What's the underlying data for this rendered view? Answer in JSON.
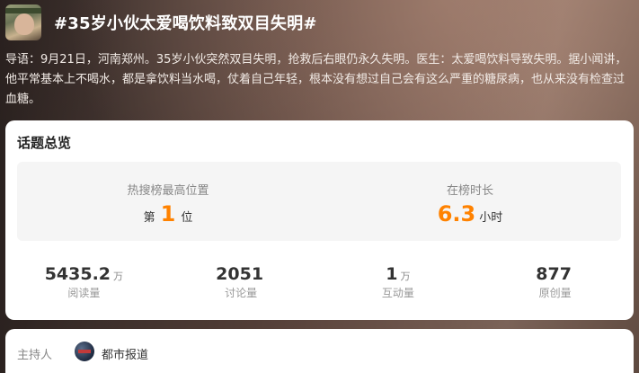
{
  "topic": {
    "title": "#35岁小伙太爱喝饮料致双目失明#",
    "thumbnail_icon": "topic-thumbnail-image",
    "intro": "导语：9月21日，河南郑州。35岁小伙突然双目失明，抢救后右眼仍永久失明。医生：太爱喝饮料导致失明。据小闻讲，他平常基本上不喝水，都是拿饮料当水喝，仗着自己年轻，根本没有想过自己会有这么严重的糖尿病，也从来没有检查过血糖。"
  },
  "overview": {
    "title": "话题总览",
    "rank": {
      "label": "热搜榜最高位置",
      "prefix": "第",
      "value": "1",
      "suffix": "位"
    },
    "duration": {
      "label": "在榜时长",
      "value": "6.3",
      "suffix": "小时"
    },
    "accent_color": "#ff8200",
    "stats": [
      {
        "value": "5435.2",
        "unit": "万",
        "label": "阅读量"
      },
      {
        "value": "2051",
        "unit": "",
        "label": "讨论量"
      },
      {
        "value": "1",
        "unit": "万",
        "label": "互动量"
      },
      {
        "value": "877",
        "unit": "",
        "label": "原创量"
      }
    ]
  },
  "host": {
    "label": "主持人",
    "name": "都市报道",
    "avatar_icon": "host-avatar"
  }
}
